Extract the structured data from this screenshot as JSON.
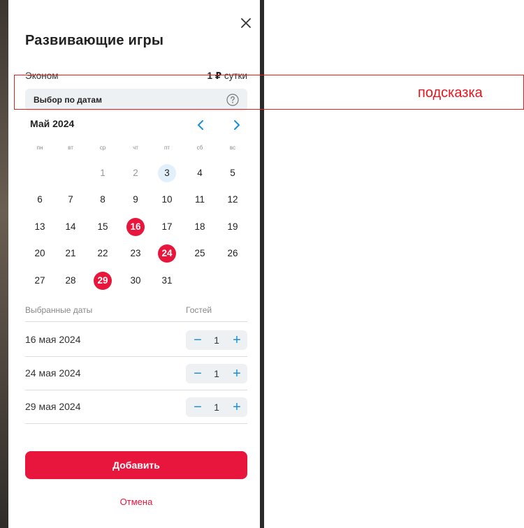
{
  "modal": {
    "title": "Развивающие игры",
    "tariff": {
      "name": "Эконом",
      "price": "1 ₽",
      "unit": "сутки"
    },
    "date_mode": {
      "label": "Выбор по датам"
    },
    "annotation": {
      "label": "подсказка"
    },
    "calendar": {
      "month_title": "Май 2024",
      "weekdays": [
        "пн",
        "вт",
        "ср",
        "чт",
        "пт",
        "сб",
        "вс"
      ],
      "days": [
        "1",
        "2",
        "3",
        "4",
        "5",
        "6",
        "7",
        "8",
        "9",
        "10",
        "11",
        "12",
        "13",
        "14",
        "15",
        "16",
        "17",
        "18",
        "19",
        "20",
        "21",
        "22",
        "23",
        "24",
        "25",
        "26",
        "27",
        "28",
        "29",
        "30",
        "31"
      ],
      "today": "3",
      "selected": [
        "16",
        "24",
        "29"
      ],
      "past": [
        "1",
        "2"
      ]
    },
    "selected_dates": {
      "header_dates": "Выбранные даты",
      "header_guests": "Гостей",
      "rows": [
        {
          "date": "16 мая 2024",
          "guests": "1"
        },
        {
          "date": "24 мая 2024",
          "guests": "1"
        },
        {
          "date": "29 мая 2024",
          "guests": "1"
        }
      ]
    },
    "stepper_minus": "−",
    "stepper_plus": "+",
    "add_button": "Добавить",
    "cancel_link": "Отмена"
  },
  "colors": {
    "accent": "#e8163c",
    "link": "#1b8fd6",
    "today_bg": "#e2f0fb",
    "annotation": "#e8141e"
  }
}
